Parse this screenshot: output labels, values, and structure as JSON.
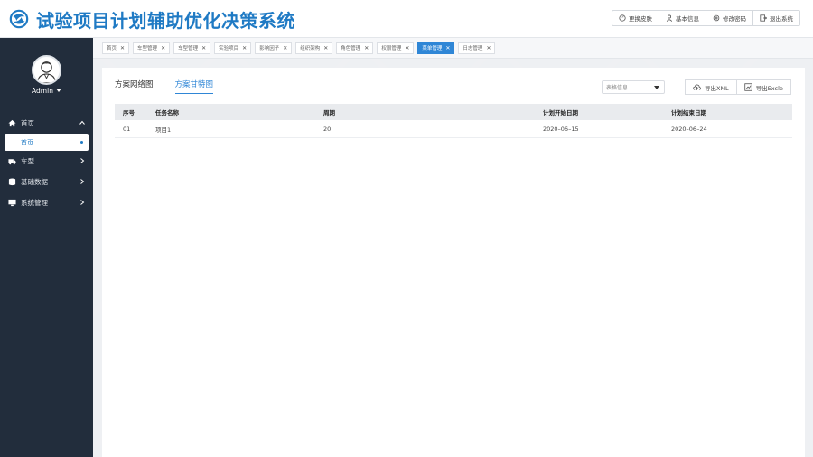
{
  "header": {
    "title": "试验项目计划辅助优化决策系统",
    "buttons": [
      {
        "label": "更换皮肤",
        "icon": "palette-icon"
      },
      {
        "label": "基本信息",
        "icon": "user-icon"
      },
      {
        "label": "修改密码",
        "icon": "gear-icon"
      },
      {
        "label": "退出系统",
        "icon": "logout-icon"
      }
    ]
  },
  "sidebar": {
    "user": "Admin",
    "menu": [
      {
        "label": "首页",
        "icon": "home-icon",
        "expanded": true
      },
      {
        "label": "车型",
        "icon": "truck-icon"
      },
      {
        "label": "基础数据",
        "icon": "database-icon"
      },
      {
        "label": "系统管理",
        "icon": "monitor-icon"
      }
    ],
    "submenu_home": "首页"
  },
  "tags": [
    {
      "label": "首页"
    },
    {
      "label": "车型管理"
    },
    {
      "label": "车型管理"
    },
    {
      "label": "实验项目"
    },
    {
      "label": "影响因子"
    },
    {
      "label": "组织架构"
    },
    {
      "label": "角色管理"
    },
    {
      "label": "权限管理"
    },
    {
      "label": "菜单管理",
      "active": true
    },
    {
      "label": "日志管理"
    }
  ],
  "main": {
    "tabs": [
      {
        "label": "方案网络图"
      },
      {
        "label": "方案甘特图",
        "active": true
      }
    ],
    "select_placeholder": "表格信息",
    "export_xml": "导出XML",
    "export_excel": "导出Excle",
    "table": {
      "headers": [
        "序号",
        "任务名称",
        "周期",
        "计划开始日期",
        "计划结束日期"
      ],
      "rows": [
        [
          "01",
          "项目1",
          "20",
          "2020–06–15",
          "2020–06–24"
        ]
      ]
    }
  },
  "colors": {
    "accent": "#2f86d6",
    "sidebar_bg": "#222d3c",
    "title": "#1f7ac4"
  }
}
